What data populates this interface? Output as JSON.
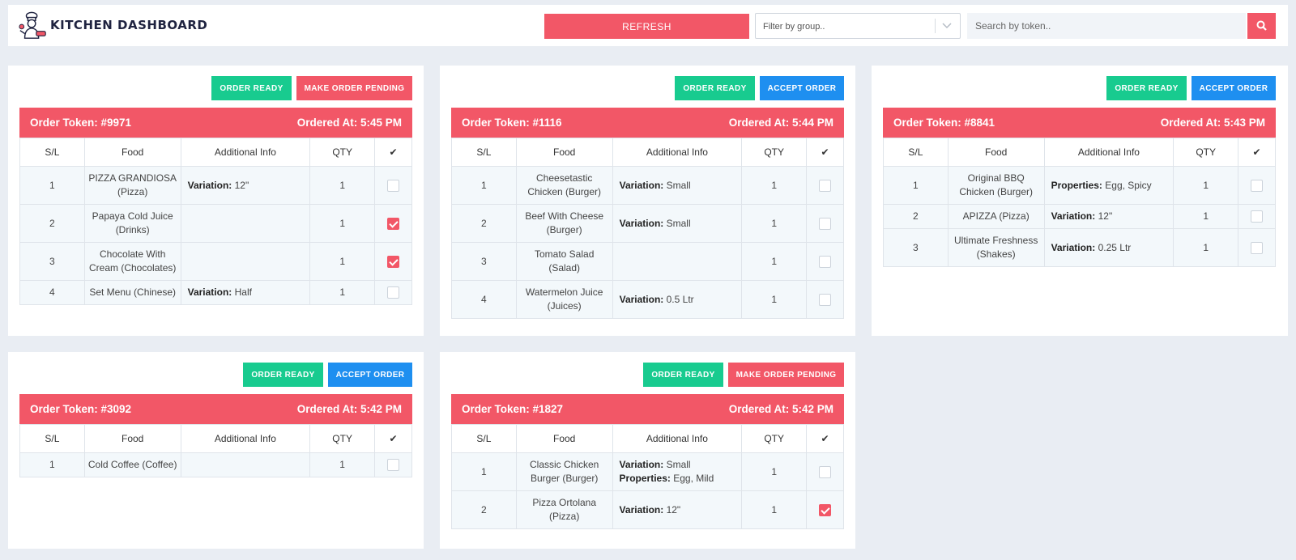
{
  "header": {
    "brand": "KITCHEN DASHBOARD",
    "refresh_label": "REFRESH",
    "filter_placeholder": "Filter by group..",
    "search_placeholder": "Search by token..",
    "logo_icon": "chef-icon",
    "search_icon": "search-icon"
  },
  "colors": {
    "primary": "#f25767",
    "success": "#18cb8f",
    "info": "#1e8ff0",
    "background": "#e9edf3"
  },
  "table_headers": {
    "sl": "S/L",
    "food": "Food",
    "info": "Additional Info",
    "qty": "QTY",
    "check": "✔"
  },
  "orders": [
    {
      "btn1": "ORDER READY",
      "btn2": "MAKE ORDER PENDING",
      "token": "Order Token: #9971",
      "ordered_at": "Ordered At: 5:45 PM",
      "items": [
        {
          "sl": "1",
          "food": "PIZZA GRANDIOSA (Pizza)",
          "info_label": "Variation:",
          "info_value": " 12\"",
          "info_label2": "",
          "info_value2": "",
          "qty": "1",
          "checked": false
        },
        {
          "sl": "2",
          "food": "Papaya Cold Juice (Drinks)",
          "info_label": "",
          "info_value": "",
          "info_label2": "",
          "info_value2": "",
          "qty": "1",
          "checked": true
        },
        {
          "sl": "3",
          "food": "Chocolate With Cream (Chocolates)",
          "info_label": "",
          "info_value": "",
          "info_label2": "",
          "info_value2": "",
          "qty": "1",
          "checked": true
        },
        {
          "sl": "4",
          "food": "Set Menu (Chinese)",
          "info_label": "Variation:",
          "info_value": " Half",
          "info_label2": "",
          "info_value2": "",
          "qty": "1",
          "checked": false
        }
      ]
    },
    {
      "btn1": "ORDER READY",
      "btn2": "ACCEPT ORDER",
      "token": "Order Token: #1116",
      "ordered_at": "Ordered At: 5:44 PM",
      "items": [
        {
          "sl": "1",
          "food": "Cheesetastic Chicken (Burger)",
          "info_label": "Variation:",
          "info_value": " Small",
          "info_label2": "",
          "info_value2": "",
          "qty": "1",
          "checked": false
        },
        {
          "sl": "2",
          "food": "Beef With Cheese (Burger)",
          "info_label": "Variation:",
          "info_value": " Small",
          "info_label2": "",
          "info_value2": "",
          "qty": "1",
          "checked": false
        },
        {
          "sl": "3",
          "food": "Tomato Salad (Salad)",
          "info_label": "",
          "info_value": "",
          "info_label2": "",
          "info_value2": "",
          "qty": "1",
          "checked": false
        },
        {
          "sl": "4",
          "food": "Watermelon Juice (Juices)",
          "info_label": "Variation:",
          "info_value": " 0.5 Ltr",
          "info_label2": "",
          "info_value2": "",
          "qty": "1",
          "checked": false
        }
      ]
    },
    {
      "btn1": "ORDER READY",
      "btn2": "ACCEPT ORDER",
      "token": "Order Token: #8841",
      "ordered_at": "Ordered At: 5:43 PM",
      "items": [
        {
          "sl": "1",
          "food": "Original BBQ Chicken (Burger)",
          "info_label": "Properties:",
          "info_value": " Egg, Spicy",
          "info_label2": "",
          "info_value2": "",
          "qty": "1",
          "checked": false
        },
        {
          "sl": "2",
          "food": "APIZZA (Pizza)",
          "info_label": "Variation:",
          "info_value": " 12\"",
          "info_label2": "",
          "info_value2": "",
          "qty": "1",
          "checked": false
        },
        {
          "sl": "3",
          "food": "Ultimate Freshness (Shakes)",
          "info_label": "Variation:",
          "info_value": " 0.25 Ltr",
          "info_label2": "",
          "info_value2": "",
          "qty": "1",
          "checked": false
        }
      ]
    },
    {
      "btn1": "ORDER READY",
      "btn2": "ACCEPT ORDER",
      "token": "Order Token: #3092",
      "ordered_at": "Ordered At: 5:42 PM",
      "items": [
        {
          "sl": "1",
          "food": "Cold Coffee (Coffee)",
          "info_label": "",
          "info_value": "",
          "info_label2": "",
          "info_value2": "",
          "qty": "1",
          "checked": false
        }
      ]
    },
    {
      "btn1": "ORDER READY",
      "btn2": "MAKE ORDER PENDING",
      "token": "Order Token: #1827",
      "ordered_at": "Ordered At: 5:42 PM",
      "items": [
        {
          "sl": "1",
          "food": "Classic Chicken Burger (Burger)",
          "info_label": "Variation:",
          "info_value": " Small",
          "info_label2": "Properties:",
          "info_value2": " Egg, Mild",
          "qty": "1",
          "checked": false
        },
        {
          "sl": "2",
          "food": "Pizza Ortolana (Pizza)",
          "info_label": "Variation:",
          "info_value": " 12\"",
          "info_label2": "",
          "info_value2": "",
          "qty": "1",
          "checked": true
        }
      ]
    }
  ]
}
